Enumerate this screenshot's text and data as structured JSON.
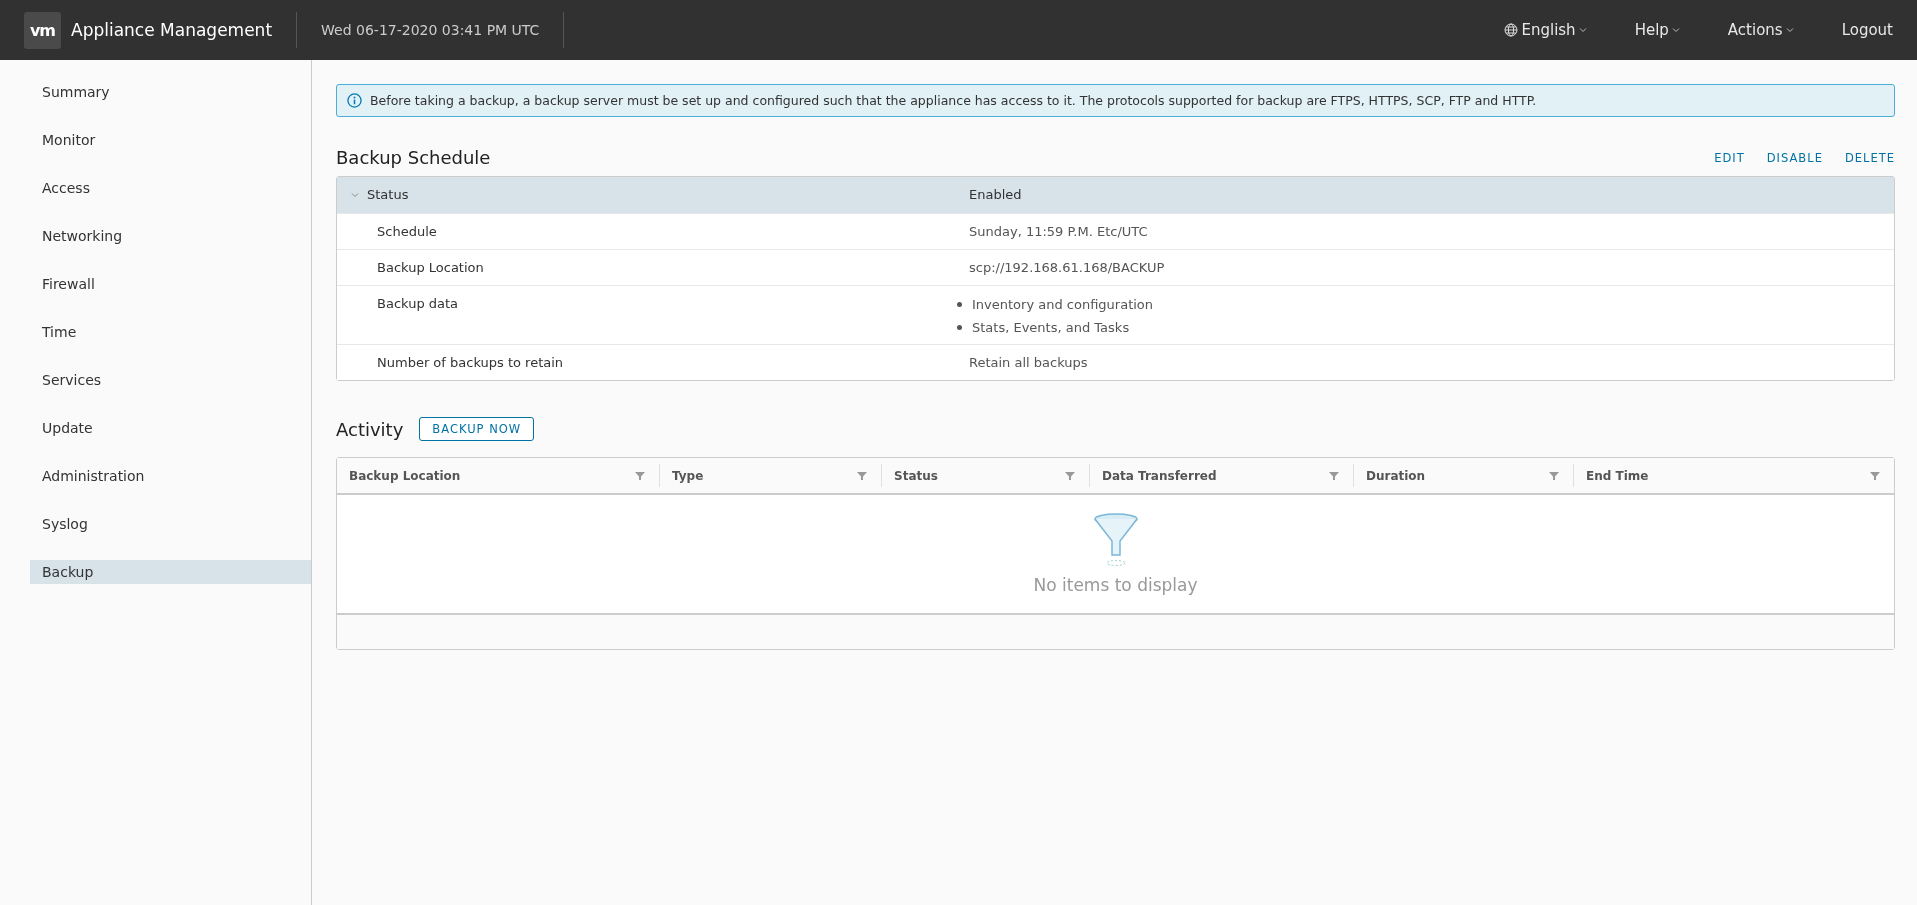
{
  "header": {
    "logo": "vm",
    "title": "Appliance Management",
    "datetime": "Wed 06-17-2020 03:41 PM UTC",
    "menus": [
      {
        "label": "English",
        "kind": "language"
      },
      {
        "label": "Help",
        "kind": "dropdown"
      },
      {
        "label": "Actions",
        "kind": "dropdown"
      },
      {
        "label": "Logout",
        "kind": "link"
      }
    ]
  },
  "sidebar": {
    "items": [
      {
        "label": "Summary",
        "selected": false
      },
      {
        "label": "Monitor",
        "selected": false
      },
      {
        "label": "Access",
        "selected": false
      },
      {
        "label": "Networking",
        "selected": false
      },
      {
        "label": "Firewall",
        "selected": false
      },
      {
        "label": "Time",
        "selected": false
      },
      {
        "label": "Services",
        "selected": false
      },
      {
        "label": "Update",
        "selected": false
      },
      {
        "label": "Administration",
        "selected": false
      },
      {
        "label": "Syslog",
        "selected": false
      },
      {
        "label": "Backup",
        "selected": true
      }
    ]
  },
  "alert": "Before taking a backup, a backup server must be set up and configured such that the appliance has access to it. The protocols supported for backup are FTPS, HTTPS, SCP, FTP and HTTP.",
  "backup_schedule": {
    "title": "Backup Schedule",
    "actions": [
      "EDIT",
      "DISABLE",
      "DELETE"
    ],
    "status": {
      "label": "Status",
      "value": "Enabled",
      "expanded": true
    },
    "rows": [
      {
        "label": "Schedule",
        "value": [
          "Sunday, 11:59 P.M. Etc/UTC"
        ],
        "kind": "text"
      },
      {
        "label": "Backup Location",
        "value": [
          "scp://192.168.61.168/BACKUP"
        ],
        "kind": "text"
      },
      {
        "label": "Backup data",
        "value": [
          "Inventory and configuration",
          "Stats, Events, and Tasks"
        ],
        "kind": "list"
      },
      {
        "label": "Number of backups to retain",
        "value": [
          "Retain all backups"
        ],
        "kind": "text"
      }
    ]
  },
  "activity": {
    "title": "Activity",
    "button": "BACKUP NOW",
    "columns": [
      "Backup Location",
      "Type",
      "Status",
      "Data Transferred",
      "Duration",
      "End Time"
    ],
    "empty_message": "No items to display"
  }
}
